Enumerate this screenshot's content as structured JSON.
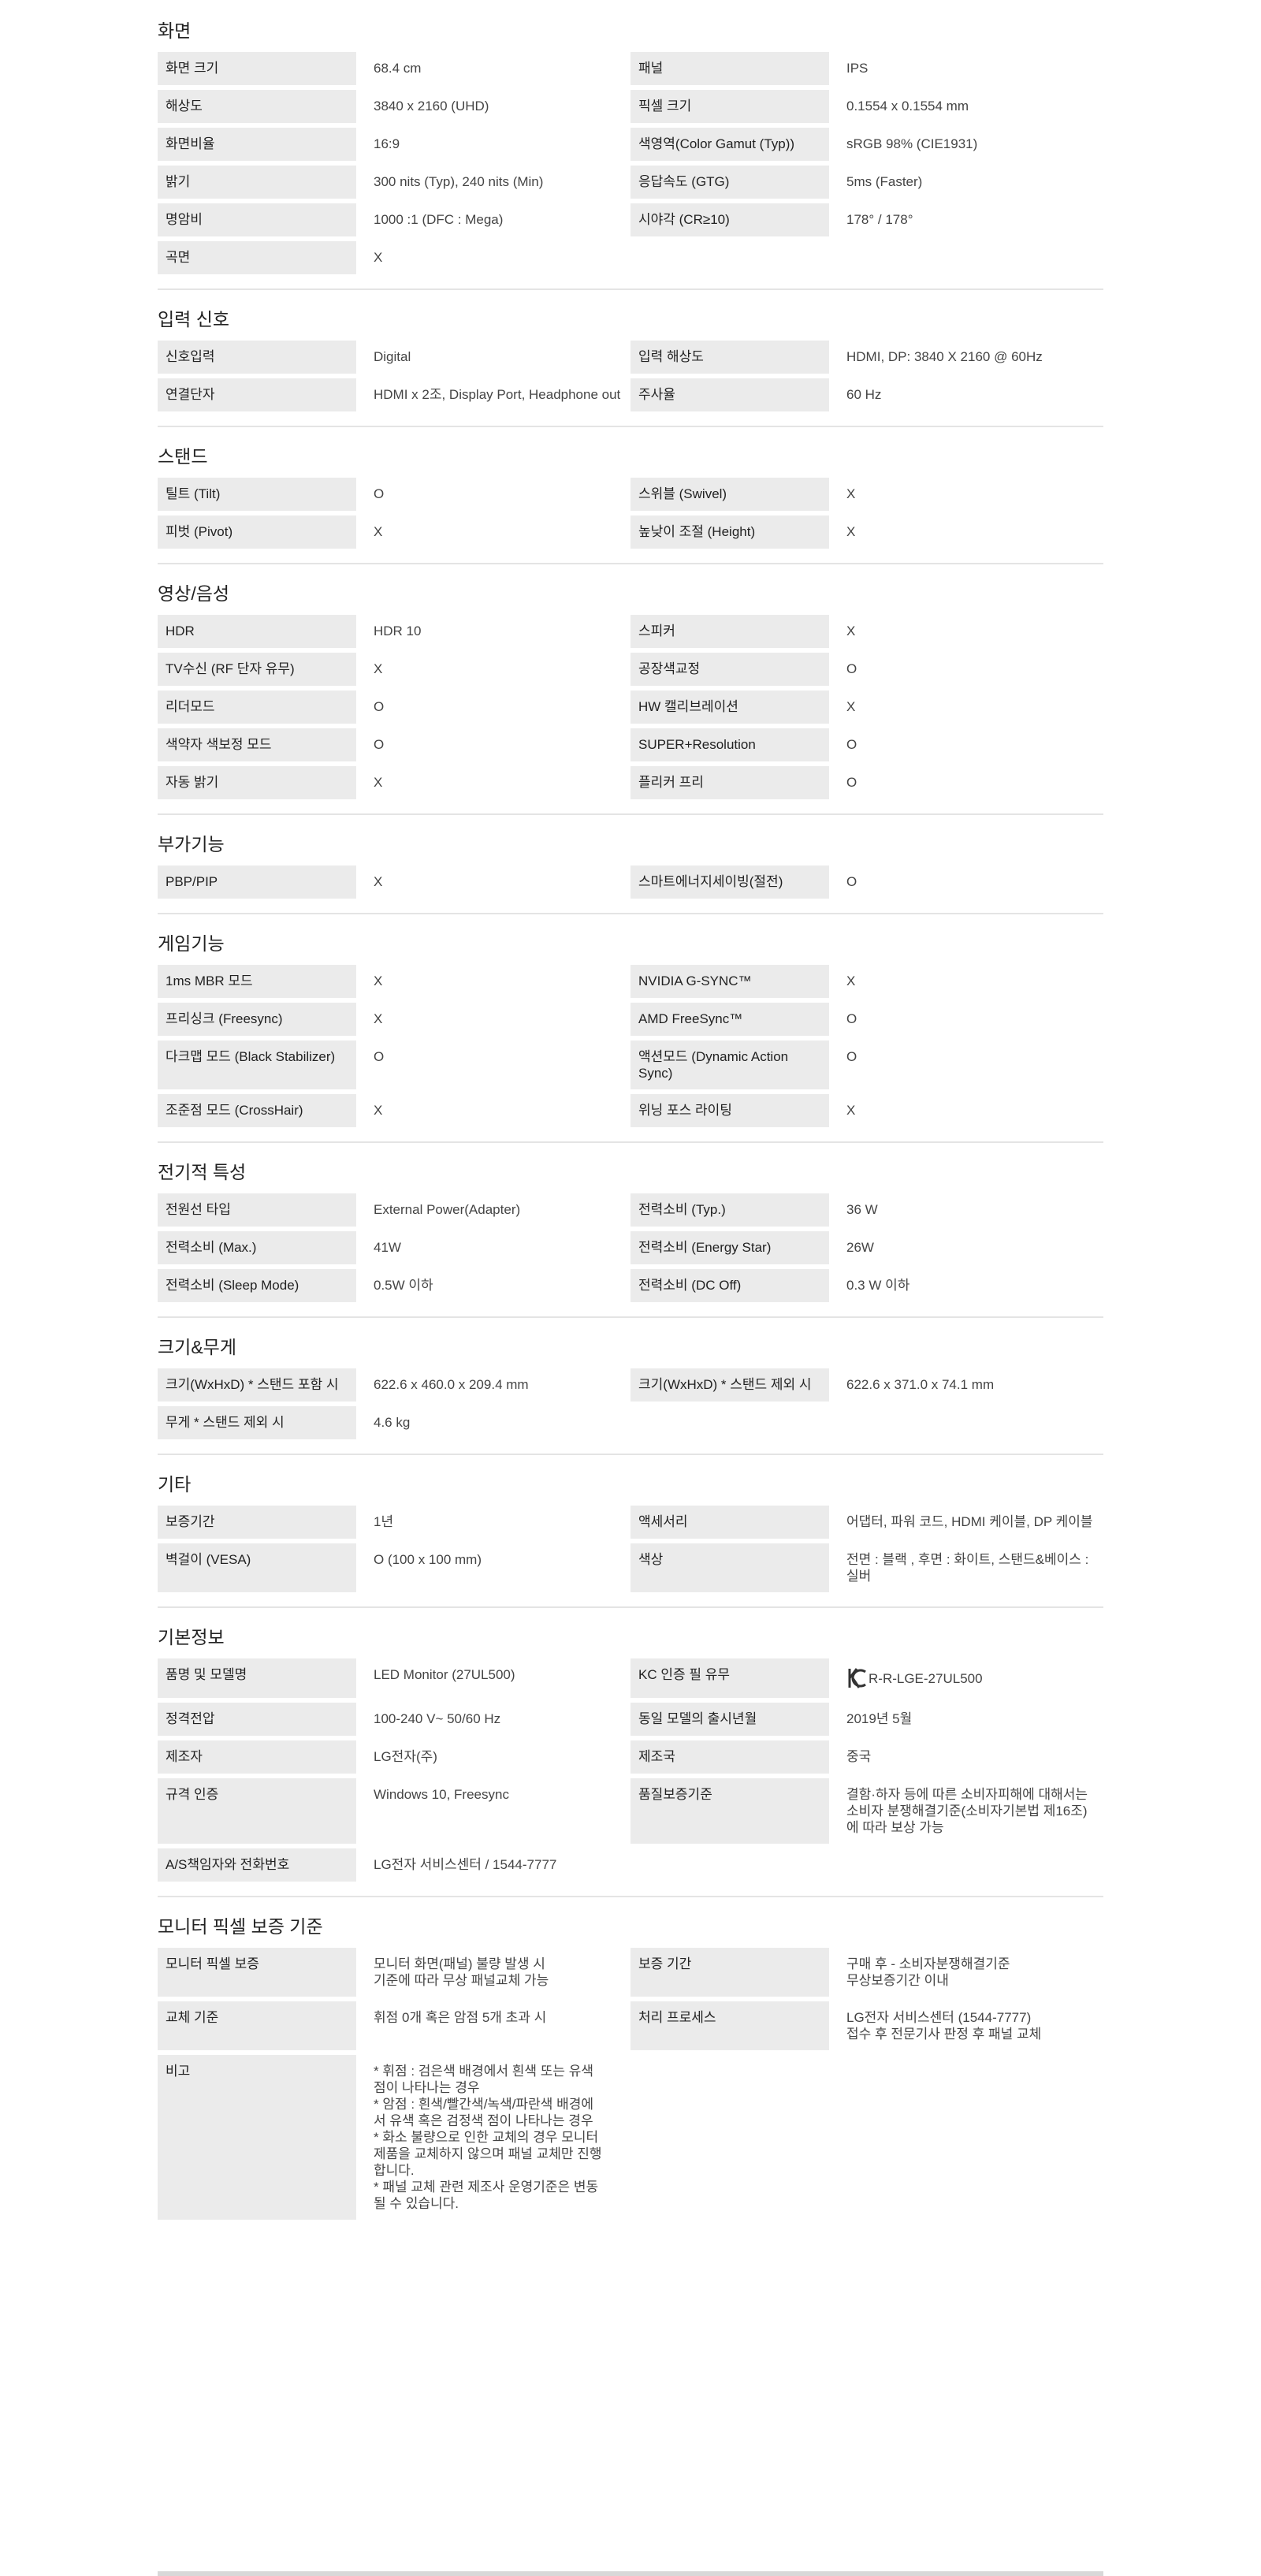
{
  "sections": [
    {
      "title": "화면",
      "rows": [
        [
          {
            "label": "화면 크기",
            "value": "68.4 cm"
          },
          {
            "label": "패널",
            "value": "IPS"
          }
        ],
        [
          {
            "label": "해상도",
            "value": "3840 x 2160 (UHD)"
          },
          {
            "label": "픽셀 크기",
            "value": "0.1554 x 0.1554 mm"
          }
        ],
        [
          {
            "label": "화면비율",
            "value": "16:9"
          },
          {
            "label": "색영역(Color Gamut (Typ))",
            "value": "sRGB 98% (CIE1931)"
          }
        ],
        [
          {
            "label": "밝기",
            "value": "300 nits (Typ), 240 nits (Min)"
          },
          {
            "label": "응답속도 (GTG)",
            "value": "5ms (Faster)"
          }
        ],
        [
          {
            "label": "명암비",
            "value": "1000 :1 (DFC : Mega)"
          },
          {
            "label": "시야각 (CR≥10)",
            "value": "178° / 178°"
          }
        ],
        [
          {
            "label": "곡면",
            "value": "X"
          }
        ]
      ]
    },
    {
      "title": "입력 신호",
      "rows": [
        [
          {
            "label": "신호입력",
            "value": "Digital"
          },
          {
            "label": "입력 해상도",
            "value": "HDMI, DP: 3840 X 2160 @ 60Hz"
          }
        ],
        [
          {
            "label": "연결단자",
            "value": "HDMI x 2조, Display Port, Headphone out"
          },
          {
            "label": "주사율",
            "value": "60 Hz"
          }
        ]
      ]
    },
    {
      "title": "스탠드",
      "rows": [
        [
          {
            "label": "틸트 (Tilt)",
            "value": "O"
          },
          {
            "label": "스위블 (Swivel)",
            "value": "X"
          }
        ],
        [
          {
            "label": "피벗 (Pivot)",
            "value": "X"
          },
          {
            "label": "높낮이 조절 (Height)",
            "value": "X"
          }
        ]
      ]
    },
    {
      "title": "영상/음성",
      "rows": [
        [
          {
            "label": "HDR",
            "value": "HDR 10"
          },
          {
            "label": "스피커",
            "value": "X"
          }
        ],
        [
          {
            "label": "TV수신 (RF 단자 유무)",
            "value": "X"
          },
          {
            "label": "공장색교정",
            "value": "O"
          }
        ],
        [
          {
            "label": "리더모드",
            "value": "O"
          },
          {
            "label": "HW 캘리브레이션",
            "value": "X"
          }
        ],
        [
          {
            "label": "색약자 색보정 모드",
            "value": "O"
          },
          {
            "label": "SUPER+Resolution",
            "value": "O"
          }
        ],
        [
          {
            "label": "자동 밝기",
            "value": "X"
          },
          {
            "label": "플리커 프리",
            "value": "O"
          }
        ]
      ]
    },
    {
      "title": "부가기능",
      "rows": [
        [
          {
            "label": "PBP/PIP",
            "value": "X"
          },
          {
            "label": "스마트에너지세이빙(절전)",
            "value": "O"
          }
        ]
      ]
    },
    {
      "title": "게임기능",
      "rows": [
        [
          {
            "label": "1ms MBR 모드",
            "value": "X"
          },
          {
            "label": "NVIDIA G-SYNC™",
            "value": "X"
          }
        ],
        [
          {
            "label": "프리싱크 (Freesync)",
            "value": "X"
          },
          {
            "label": "AMD FreeSync™",
            "value": "O"
          }
        ],
        [
          {
            "label": "다크맵 모드 (Black Stabilizer)",
            "value": "O"
          },
          {
            "label": "액션모드 (Dynamic Action Sync)",
            "value": "O"
          }
        ],
        [
          {
            "label": "조준점 모드 (CrossHair)",
            "value": "X"
          },
          {
            "label": "위닝 포스 라이팅",
            "value": "X"
          }
        ]
      ]
    },
    {
      "title": "전기적 특성",
      "rows": [
        [
          {
            "label": "전원선 타입",
            "value": "External Power(Adapter)"
          },
          {
            "label": "전력소비 (Typ.)",
            "value": "36 W"
          }
        ],
        [
          {
            "label": "전력소비 (Max.)",
            "value": "41W"
          },
          {
            "label": "전력소비 (Energy Star)",
            "value": "26W"
          }
        ],
        [
          {
            "label": "전력소비 (Sleep Mode)",
            "value": "0.5W 이하"
          },
          {
            "label": "전력소비 (DC Off)",
            "value": "0.3 W 이하"
          }
        ]
      ]
    },
    {
      "title": "크기&무게",
      "rows": [
        [
          {
            "label": "크기(WxHxD) * 스탠드 포함 시",
            "value": "622.6 x 460.0 x 209.4 mm"
          },
          {
            "label": "크기(WxHxD) * 스탠드 제외 시",
            "value": "622.6 x 371.0 x 74.1 mm"
          }
        ],
        [
          {
            "label": "무게 * 스탠드 제외 시",
            "value": "4.6 kg"
          }
        ]
      ]
    },
    {
      "title": "기타",
      "rows": [
        [
          {
            "label": "보증기간",
            "value": "1년"
          },
          {
            "label": "액세서리",
            "value": "어댑터, 파워 코드, HDMI 케이블, DP 케이블"
          }
        ],
        [
          {
            "label": "벽걸이 (VESA)",
            "value": "O (100 x 100 mm)"
          },
          {
            "label": "색상",
            "value": "전면 : 블랙 , 후면 : 화이트, 스탠드&베이스 : 실버"
          }
        ]
      ]
    },
    {
      "title": "기본정보",
      "rows": [
        [
          {
            "label": "품명 및 모델명",
            "value": "LED Monitor (27UL500)"
          },
          {
            "label": "KC 인증 필 유무",
            "value": "R-R-LGE-27UL500",
            "kc": true
          }
        ],
        [
          {
            "label": "정격전압",
            "value": "100-240 V~ 50/60 Hz"
          },
          {
            "label": "동일 모델의 출시년월",
            "value": "2019년 5월"
          }
        ],
        [
          {
            "label": "제조자",
            "value": "LG전자(주)"
          },
          {
            "label": "제조국",
            "value": "중국"
          }
        ],
        [
          {
            "label": "규격 인증",
            "value": "Windows 10, Freesync"
          },
          {
            "label": "품질보증기준",
            "value": "결함·하자 등에 따른 소비자피해에 대해서는 소비자 분쟁해결기준(소비자기본법 제16조)에 따라 보상 가능"
          }
        ],
        [
          {
            "label": "A/S책임자와 전화번호",
            "value": "LG전자 서비스센터 / 1544-7777",
            "wide": true
          }
        ]
      ]
    },
    {
      "title": "모니터 픽셀 보증 기준",
      "rows": [
        [
          {
            "label": "모니터 픽셀 보증",
            "value": "모니터 화면(패널) 불량 발생 시\n기준에 따라 무상 패널교체 가능"
          },
          {
            "label": "보증 기간",
            "value": "구매 후 - 소비자분쟁해결기준\n무상보증기간 이내"
          }
        ],
        [
          {
            "label": "교체 기준",
            "value": "휘점 0개 혹은 암점 5개 초과 시"
          },
          {
            "label": "처리 프로세스",
            "value": "LG전자 서비스센터 (1544-7777)\n접수 후 전문기사 판정 후 패널 교체"
          }
        ],
        [
          {
            "label": "비고",
            "value": "* 휘점 : 검은색 배경에서 흰색 또는 유색\n점이 나타나는 경우\n* 암점 : 흰색/빨간색/녹색/파란색 배경에\n서 유색 혹은 검정색 점이 나타나는 경우\n* 화소 불량으로 인한 교체의 경우 모니터\n제품을 교체하지 않으며 패널 교체만 진행\n합니다.\n* 패널 교체 관련 제조사 운영기준은 변동\n될 수 있습니다."
          }
        ]
      ]
    }
  ]
}
